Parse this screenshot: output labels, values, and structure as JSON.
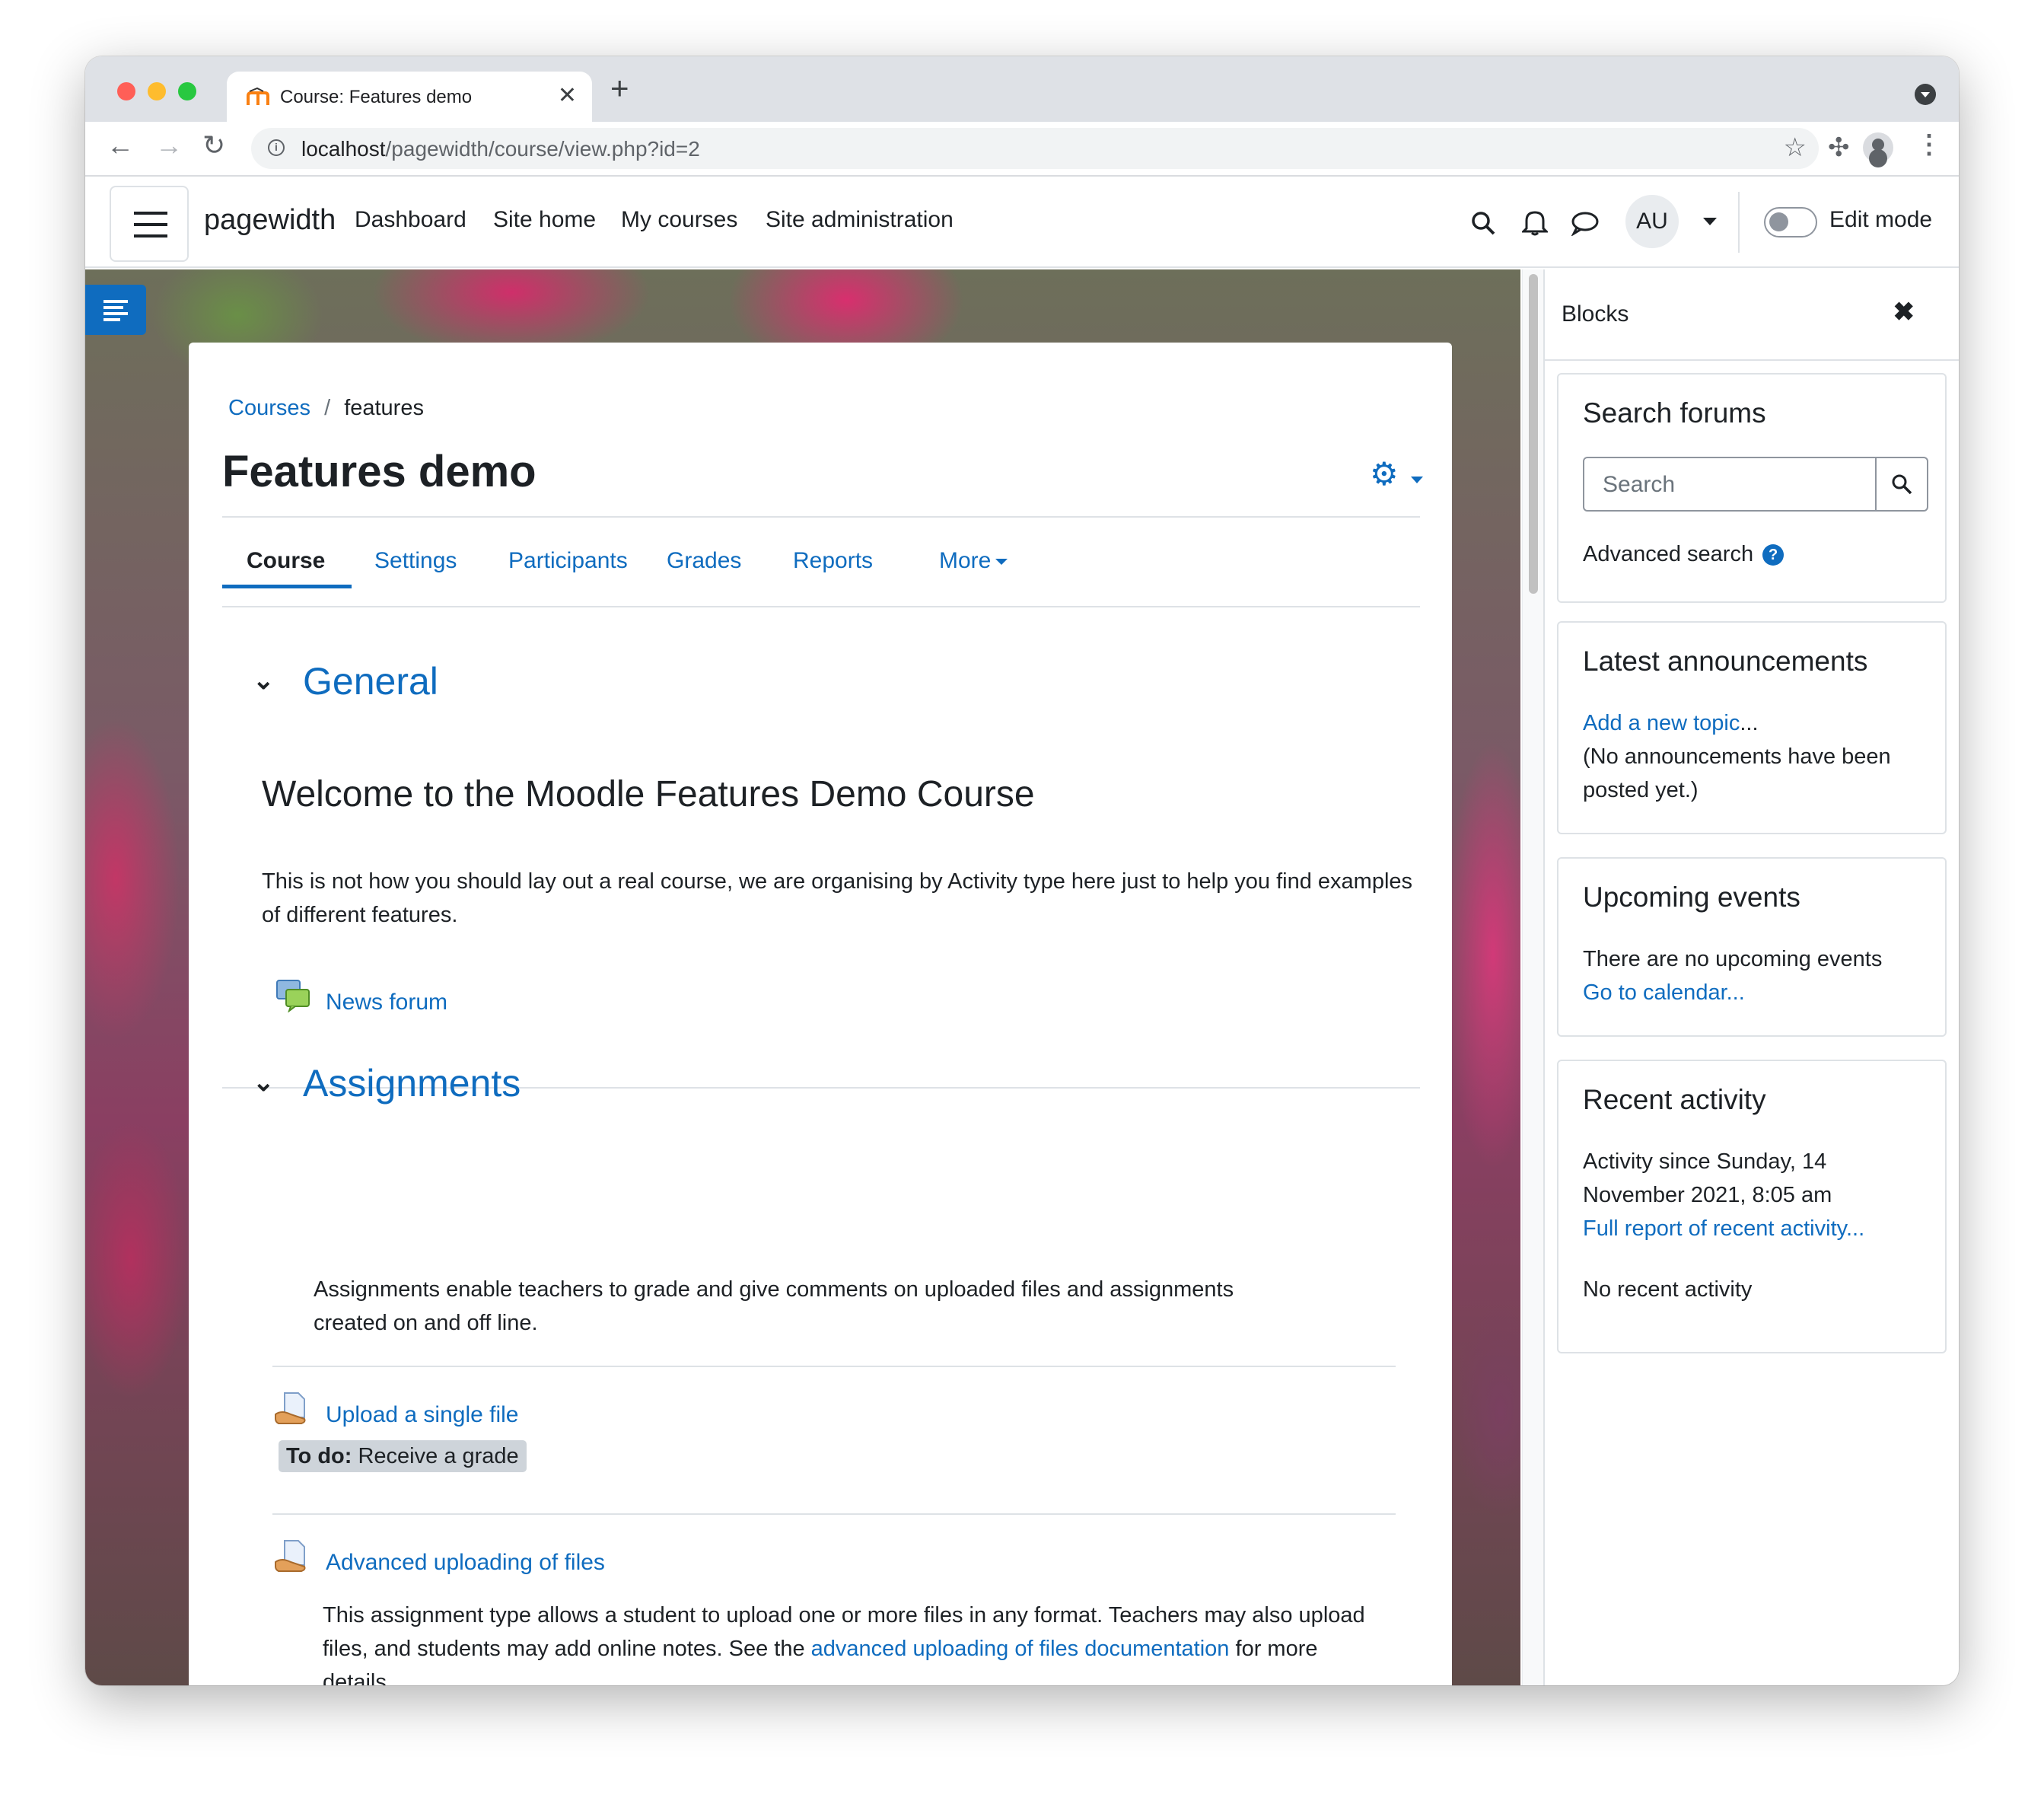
{
  "browser": {
    "tab_title": "Course: Features demo",
    "tab_close": "✕",
    "new_tab": "+",
    "url_host": "localhost",
    "url_path": "/pagewidth/course/view.php?id=2"
  },
  "navbar": {
    "brand": "pagewidth",
    "links": [
      "Dashboard",
      "Site home",
      "My courses",
      "Site administration"
    ],
    "user_initials": "AU",
    "edit_mode_label": "Edit mode"
  },
  "course": {
    "breadcrumb": [
      "Courses",
      "features"
    ],
    "breadcrumb_sep": "/",
    "title": "Features demo",
    "tabs": [
      "Course",
      "Settings",
      "Participants",
      "Grades",
      "Reports",
      "More"
    ],
    "sections": {
      "general": {
        "title": "General",
        "welcome": "Welcome to the Moodle Features Demo Course",
        "summary": "This is not how you should lay out a real course, we are organising by Activity type here just to help you find examples of different features.",
        "news_forum": "News forum"
      },
      "assignments": {
        "title": "Assignments",
        "summary": "Assignments enable teachers to grade and give comments on uploaded files and assignments created on and off line.",
        "upload_single": "Upload a single file",
        "todo_label": "To do:",
        "todo_value": "Receive a grade",
        "advanced_upload": "Advanced uploading of files",
        "advanced_desc_1": "This assignment type allows a student to upload one or more files in any format. Teachers may also upload files, and students may add online notes. See the",
        "advanced_desc_link": "advanced uploading of files documentation",
        "advanced_desc_2": "for more details."
      }
    }
  },
  "drawer": {
    "title": "Blocks",
    "search_forums": {
      "title": "Search forums",
      "placeholder": "Search",
      "advanced": "Advanced search"
    },
    "announcements": {
      "title": "Latest announcements",
      "add_topic": "Add a new topic",
      "ellipsis": "...",
      "empty": "(No announcements have been posted yet.)"
    },
    "upcoming": {
      "title": "Upcoming events",
      "empty": "There are no upcoming events",
      "calendar_link": "Go to calendar..."
    },
    "recent": {
      "title": "Recent activity",
      "since": "Activity since Sunday, 14 November 2021, 8:05 am",
      "full_report": "Full report of recent activity...",
      "empty": "No recent activity"
    }
  }
}
